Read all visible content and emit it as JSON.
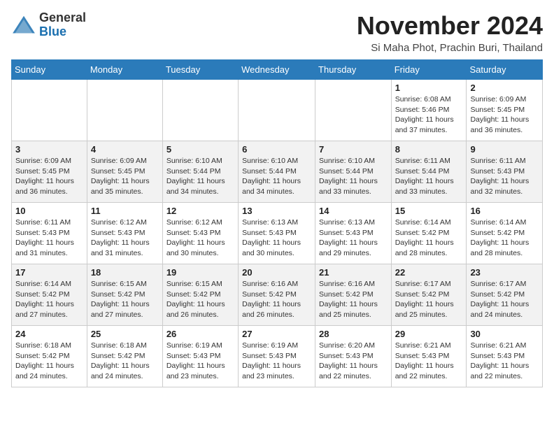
{
  "logo": {
    "general": "General",
    "blue": "Blue"
  },
  "header": {
    "month": "November 2024",
    "location": "Si Maha Phot, Prachin Buri, Thailand"
  },
  "weekdays": [
    "Sunday",
    "Monday",
    "Tuesday",
    "Wednesday",
    "Thursday",
    "Friday",
    "Saturday"
  ],
  "weeks": [
    [
      {
        "day": "",
        "detail": ""
      },
      {
        "day": "",
        "detail": ""
      },
      {
        "day": "",
        "detail": ""
      },
      {
        "day": "",
        "detail": ""
      },
      {
        "day": "",
        "detail": ""
      },
      {
        "day": "1",
        "detail": "Sunrise: 6:08 AM\nSunset: 5:46 PM\nDaylight: 11 hours and 37 minutes."
      },
      {
        "day": "2",
        "detail": "Sunrise: 6:09 AM\nSunset: 5:45 PM\nDaylight: 11 hours and 36 minutes."
      }
    ],
    [
      {
        "day": "3",
        "detail": "Sunrise: 6:09 AM\nSunset: 5:45 PM\nDaylight: 11 hours and 36 minutes."
      },
      {
        "day": "4",
        "detail": "Sunrise: 6:09 AM\nSunset: 5:45 PM\nDaylight: 11 hours and 35 minutes."
      },
      {
        "day": "5",
        "detail": "Sunrise: 6:10 AM\nSunset: 5:44 PM\nDaylight: 11 hours and 34 minutes."
      },
      {
        "day": "6",
        "detail": "Sunrise: 6:10 AM\nSunset: 5:44 PM\nDaylight: 11 hours and 34 minutes."
      },
      {
        "day": "7",
        "detail": "Sunrise: 6:10 AM\nSunset: 5:44 PM\nDaylight: 11 hours and 33 minutes."
      },
      {
        "day": "8",
        "detail": "Sunrise: 6:11 AM\nSunset: 5:44 PM\nDaylight: 11 hours and 33 minutes."
      },
      {
        "day": "9",
        "detail": "Sunrise: 6:11 AM\nSunset: 5:43 PM\nDaylight: 11 hours and 32 minutes."
      }
    ],
    [
      {
        "day": "10",
        "detail": "Sunrise: 6:11 AM\nSunset: 5:43 PM\nDaylight: 11 hours and 31 minutes."
      },
      {
        "day": "11",
        "detail": "Sunrise: 6:12 AM\nSunset: 5:43 PM\nDaylight: 11 hours and 31 minutes."
      },
      {
        "day": "12",
        "detail": "Sunrise: 6:12 AM\nSunset: 5:43 PM\nDaylight: 11 hours and 30 minutes."
      },
      {
        "day": "13",
        "detail": "Sunrise: 6:13 AM\nSunset: 5:43 PM\nDaylight: 11 hours and 30 minutes."
      },
      {
        "day": "14",
        "detail": "Sunrise: 6:13 AM\nSunset: 5:43 PM\nDaylight: 11 hours and 29 minutes."
      },
      {
        "day": "15",
        "detail": "Sunrise: 6:14 AM\nSunset: 5:42 PM\nDaylight: 11 hours and 28 minutes."
      },
      {
        "day": "16",
        "detail": "Sunrise: 6:14 AM\nSunset: 5:42 PM\nDaylight: 11 hours and 28 minutes."
      }
    ],
    [
      {
        "day": "17",
        "detail": "Sunrise: 6:14 AM\nSunset: 5:42 PM\nDaylight: 11 hours and 27 minutes."
      },
      {
        "day": "18",
        "detail": "Sunrise: 6:15 AM\nSunset: 5:42 PM\nDaylight: 11 hours and 27 minutes."
      },
      {
        "day": "19",
        "detail": "Sunrise: 6:15 AM\nSunset: 5:42 PM\nDaylight: 11 hours and 26 minutes."
      },
      {
        "day": "20",
        "detail": "Sunrise: 6:16 AM\nSunset: 5:42 PM\nDaylight: 11 hours and 26 minutes."
      },
      {
        "day": "21",
        "detail": "Sunrise: 6:16 AM\nSunset: 5:42 PM\nDaylight: 11 hours and 25 minutes."
      },
      {
        "day": "22",
        "detail": "Sunrise: 6:17 AM\nSunset: 5:42 PM\nDaylight: 11 hours and 25 minutes."
      },
      {
        "day": "23",
        "detail": "Sunrise: 6:17 AM\nSunset: 5:42 PM\nDaylight: 11 hours and 24 minutes."
      }
    ],
    [
      {
        "day": "24",
        "detail": "Sunrise: 6:18 AM\nSunset: 5:42 PM\nDaylight: 11 hours and 24 minutes."
      },
      {
        "day": "25",
        "detail": "Sunrise: 6:18 AM\nSunset: 5:42 PM\nDaylight: 11 hours and 24 minutes."
      },
      {
        "day": "26",
        "detail": "Sunrise: 6:19 AM\nSunset: 5:43 PM\nDaylight: 11 hours and 23 minutes."
      },
      {
        "day": "27",
        "detail": "Sunrise: 6:19 AM\nSunset: 5:43 PM\nDaylight: 11 hours and 23 minutes."
      },
      {
        "day": "28",
        "detail": "Sunrise: 6:20 AM\nSunset: 5:43 PM\nDaylight: 11 hours and 22 minutes."
      },
      {
        "day": "29",
        "detail": "Sunrise: 6:21 AM\nSunset: 5:43 PM\nDaylight: 11 hours and 22 minutes."
      },
      {
        "day": "30",
        "detail": "Sunrise: 6:21 AM\nSunset: 5:43 PM\nDaylight: 11 hours and 22 minutes."
      }
    ]
  ]
}
